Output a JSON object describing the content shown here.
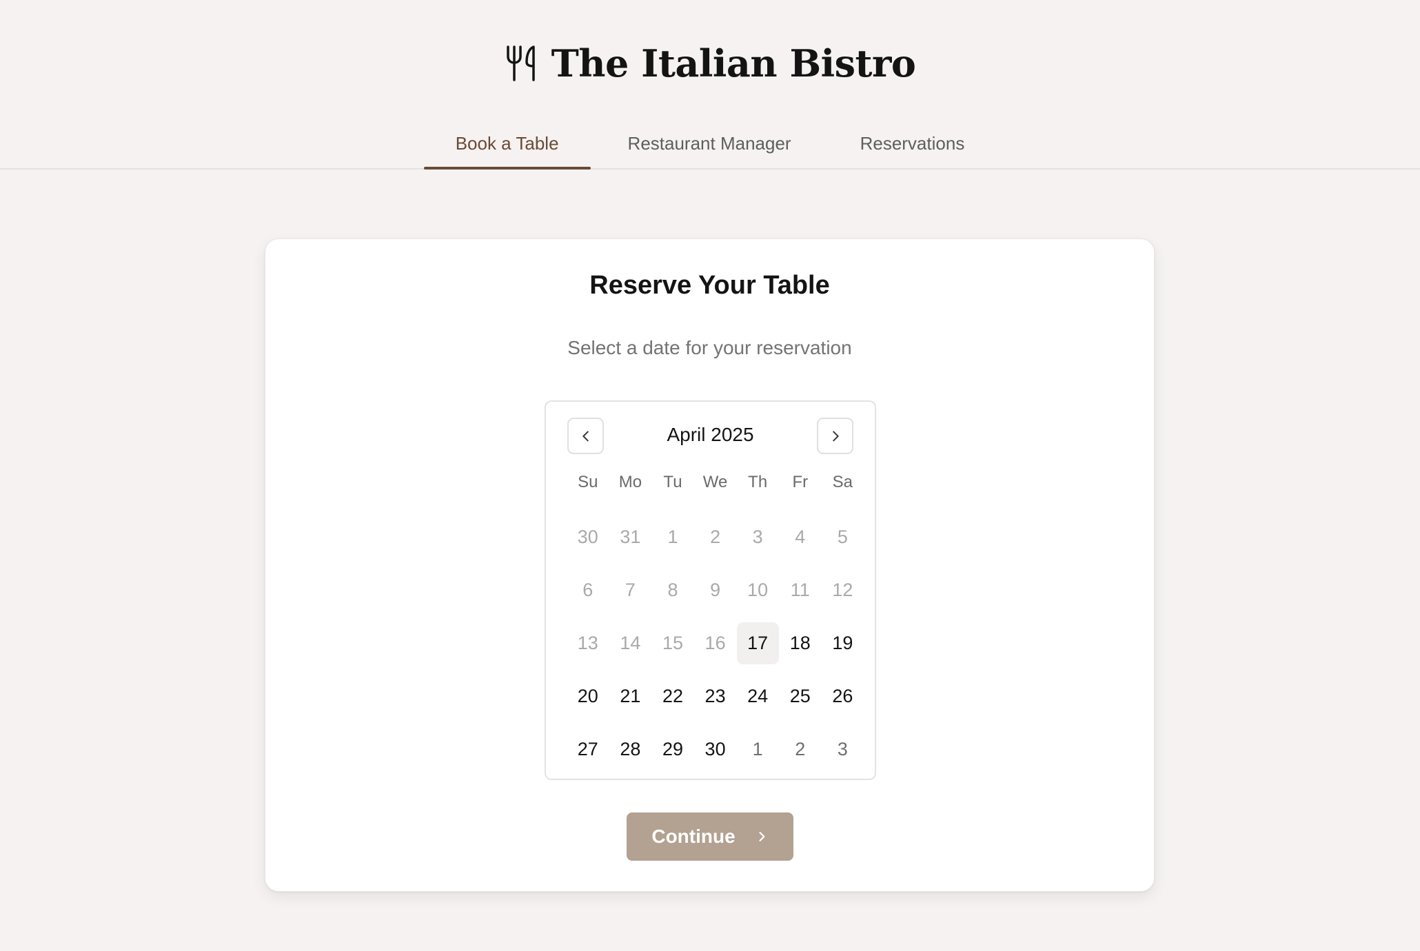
{
  "header": {
    "title": "The Italian Bistro",
    "icon": "utensils-icon"
  },
  "tabs": [
    {
      "label": "Book a Table",
      "active": true
    },
    {
      "label": "Restaurant Manager",
      "active": false
    },
    {
      "label": "Reservations",
      "active": false
    }
  ],
  "booking": {
    "title": "Reserve Your Table",
    "subtitle": "Select a date for your reservation",
    "continue_label": "Continue"
  },
  "calendar": {
    "month_label": "April 2025",
    "prev_icon": "chevron-left-icon",
    "next_icon": "chevron-right-icon",
    "weekdays": [
      "Su",
      "Mo",
      "Tu",
      "We",
      "Th",
      "Fr",
      "Sa"
    ],
    "days": [
      {
        "label": "30",
        "state": "disabled"
      },
      {
        "label": "31",
        "state": "disabled"
      },
      {
        "label": "1",
        "state": "disabled"
      },
      {
        "label": "2",
        "state": "disabled"
      },
      {
        "label": "3",
        "state": "disabled"
      },
      {
        "label": "4",
        "state": "disabled"
      },
      {
        "label": "5",
        "state": "disabled"
      },
      {
        "label": "6",
        "state": "disabled"
      },
      {
        "label": "7",
        "state": "disabled"
      },
      {
        "label": "8",
        "state": "disabled"
      },
      {
        "label": "9",
        "state": "disabled"
      },
      {
        "label": "10",
        "state": "disabled"
      },
      {
        "label": "11",
        "state": "disabled"
      },
      {
        "label": "12",
        "state": "disabled"
      },
      {
        "label": "13",
        "state": "disabled"
      },
      {
        "label": "14",
        "state": "disabled"
      },
      {
        "label": "15",
        "state": "disabled"
      },
      {
        "label": "16",
        "state": "disabled"
      },
      {
        "label": "17",
        "state": "today"
      },
      {
        "label": "18",
        "state": "available"
      },
      {
        "label": "19",
        "state": "available"
      },
      {
        "label": "20",
        "state": "available"
      },
      {
        "label": "21",
        "state": "available"
      },
      {
        "label": "22",
        "state": "available"
      },
      {
        "label": "23",
        "state": "available"
      },
      {
        "label": "24",
        "state": "available"
      },
      {
        "label": "25",
        "state": "available"
      },
      {
        "label": "26",
        "state": "available"
      },
      {
        "label": "27",
        "state": "available"
      },
      {
        "label": "28",
        "state": "available"
      },
      {
        "label": "29",
        "state": "available"
      },
      {
        "label": "30",
        "state": "available"
      },
      {
        "label": "1",
        "state": "outside"
      },
      {
        "label": "2",
        "state": "outside"
      },
      {
        "label": "3",
        "state": "outside"
      }
    ]
  },
  "colors": {
    "accent": "#6a4a34",
    "button": "#b3a191",
    "background": "#f5f2f1"
  }
}
